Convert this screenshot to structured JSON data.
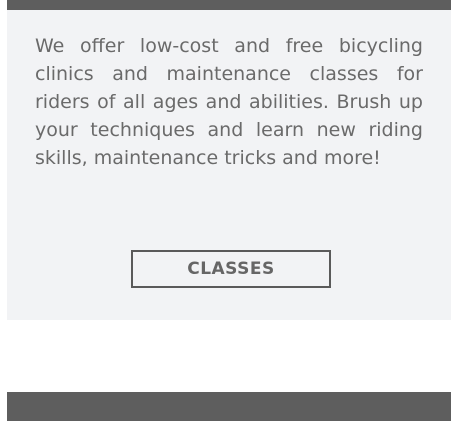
{
  "card": {
    "description": "We offer low-cost and free bicycling clinics and maintenance classes for riders of all ages and abilities. Brush up your techniques and learn new riding skills, maintenance tricks and more!",
    "button_label": "CLASSES"
  },
  "colors": {
    "bar": "#5e5e5e",
    "card_background": "#f2f3f5",
    "text": "#6a6a6a",
    "button_border": "#5a5a5a"
  }
}
